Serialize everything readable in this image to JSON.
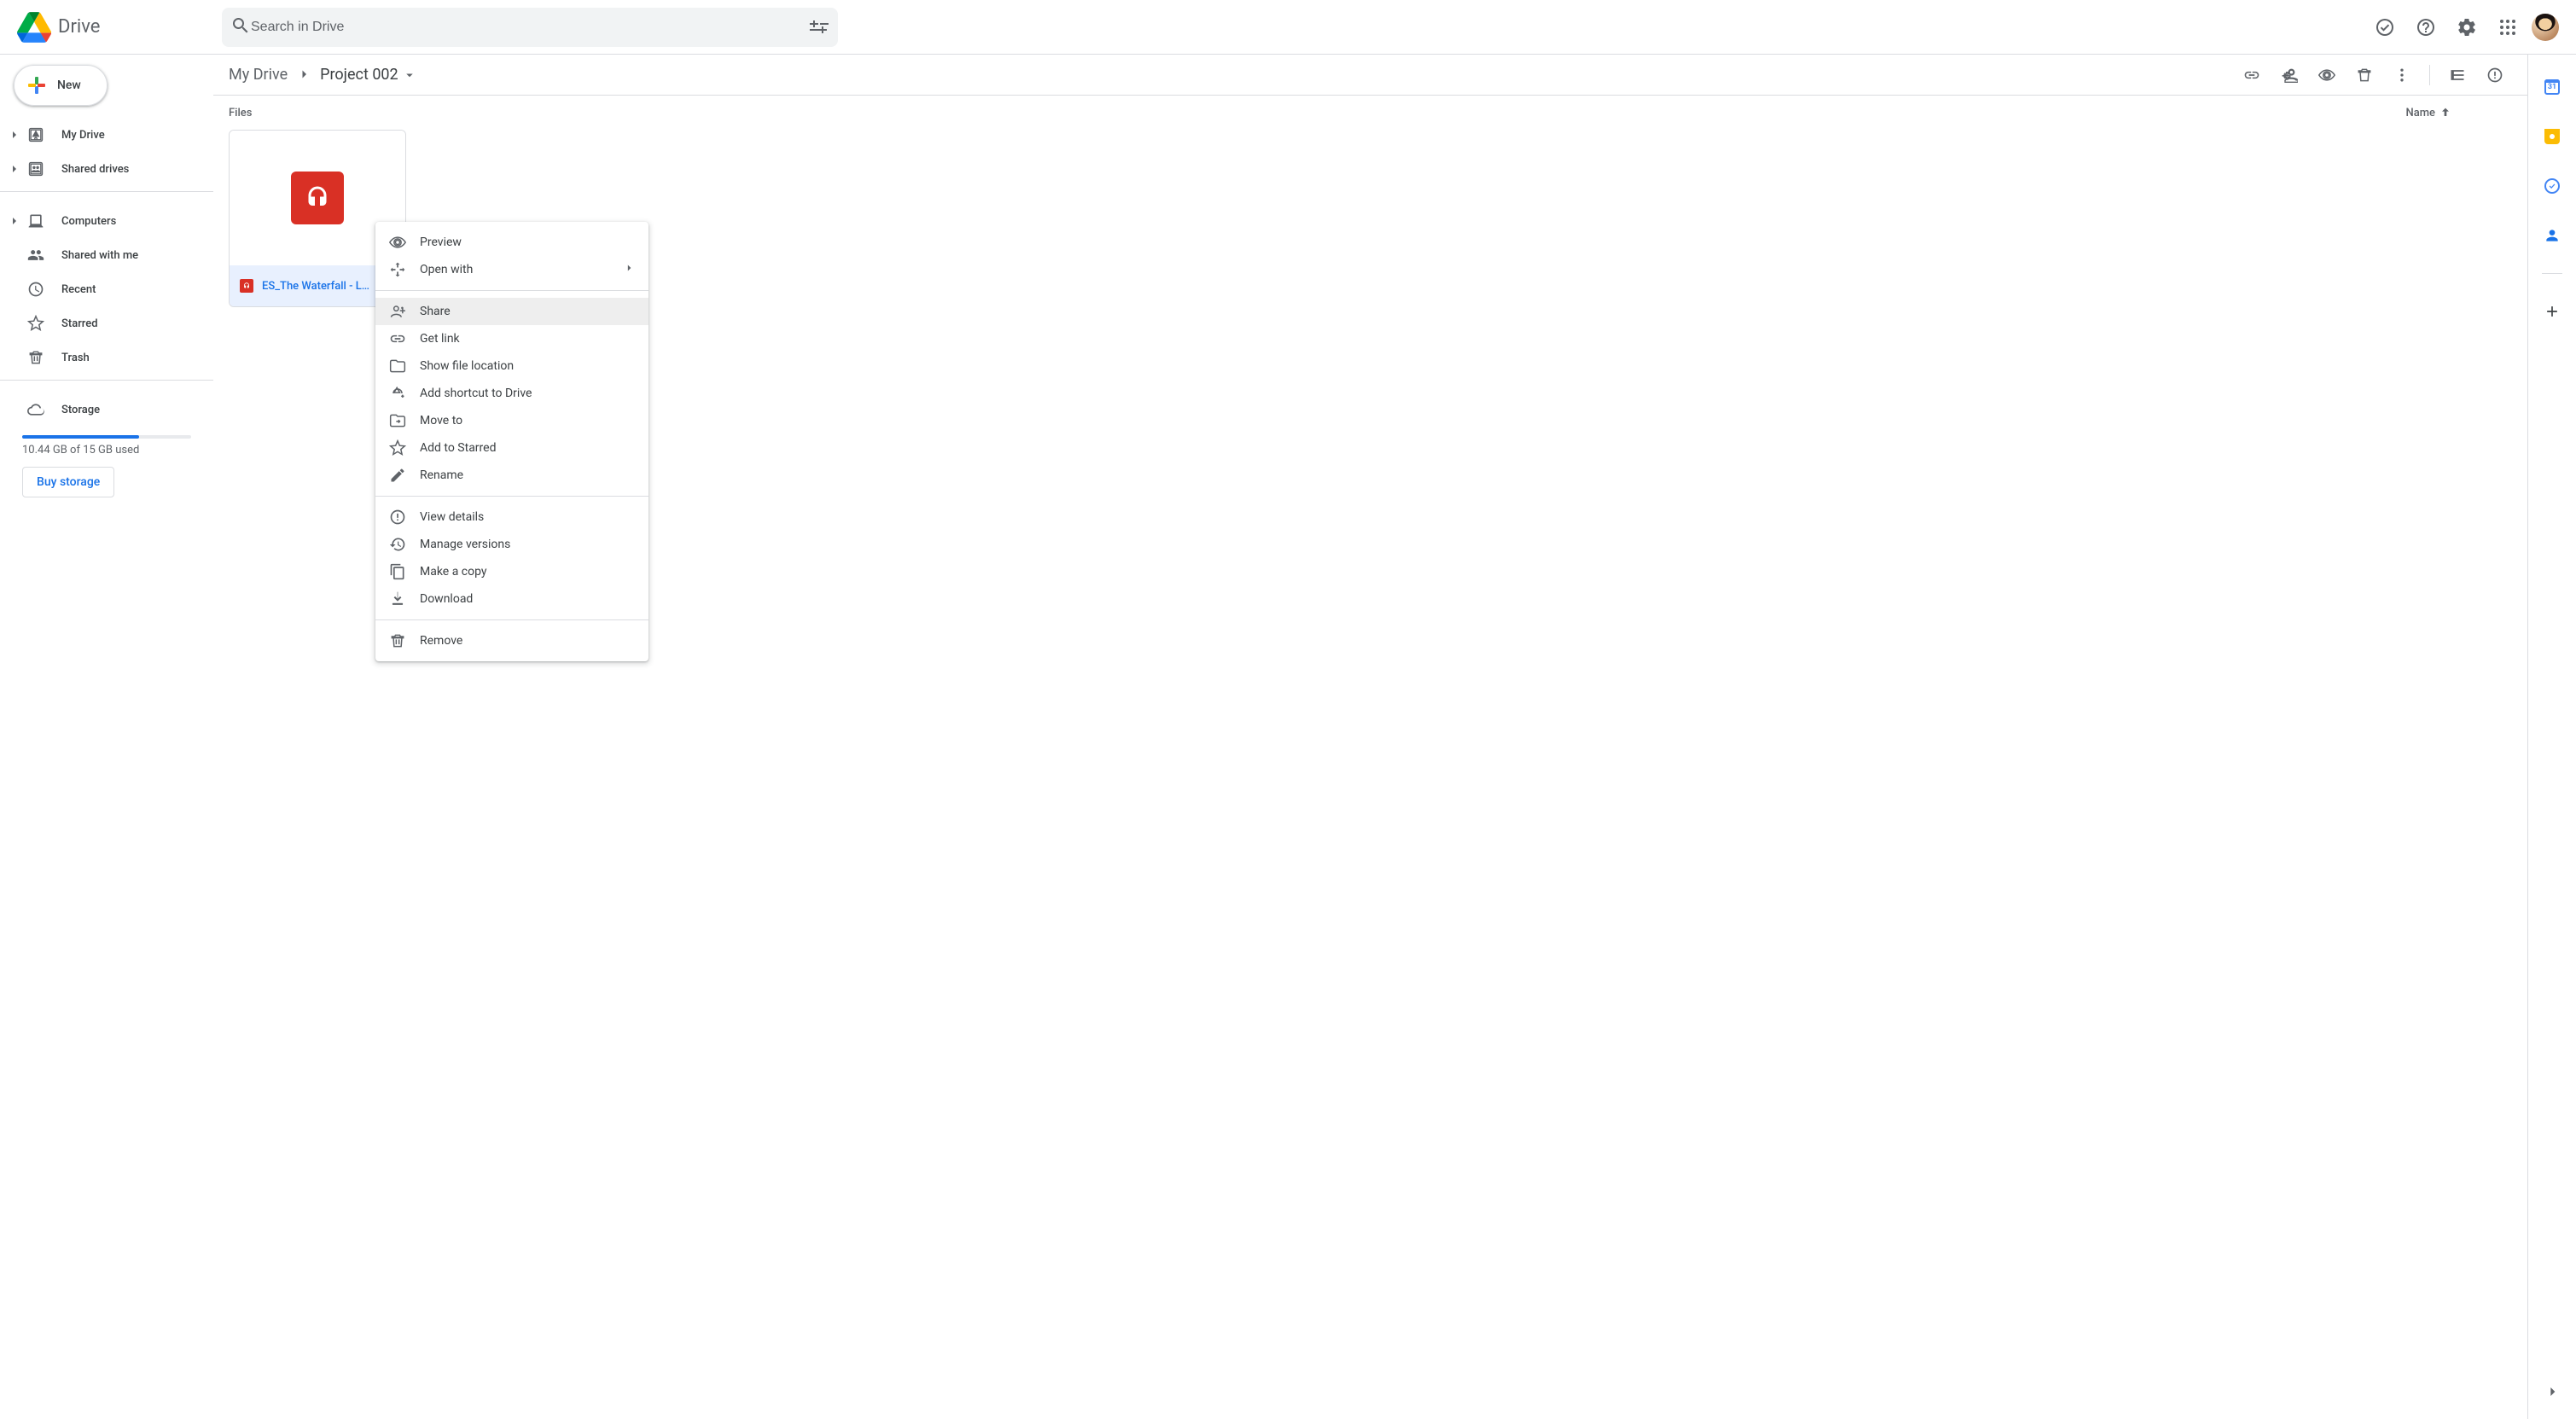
{
  "app": {
    "name": "Drive"
  },
  "search": {
    "placeholder": "Search in Drive"
  },
  "newButton": "New",
  "sidebar": {
    "myDrive": "My Drive",
    "sharedDrives": "Shared drives",
    "computers": "Computers",
    "sharedWithMe": "Shared with me",
    "recent": "Recent",
    "starred": "Starred",
    "trash": "Trash",
    "storage": "Storage",
    "storageUsed": "10.44 GB of 15 GB used",
    "storageFillPercent": 69,
    "buyStorage": "Buy storage"
  },
  "breadcrumb": {
    "root": "My Drive",
    "current": "Project 002"
  },
  "listHeader": {
    "files": "Files",
    "name": "Name"
  },
  "file": {
    "name": "ES_The Waterfall - L…"
  },
  "contextMenu": {
    "preview": "Preview",
    "openWith": "Open with",
    "share": "Share",
    "getLink": "Get link",
    "showLocation": "Show file location",
    "addShortcut": "Add shortcut to Drive",
    "moveTo": "Move to",
    "addStarred": "Add to Starred",
    "rename": "Rename",
    "viewDetails": "View details",
    "manageVersions": "Manage versions",
    "makeCopy": "Make a copy",
    "download": "Download",
    "remove": "Remove"
  },
  "sidepanel": {
    "calDay": "31"
  }
}
